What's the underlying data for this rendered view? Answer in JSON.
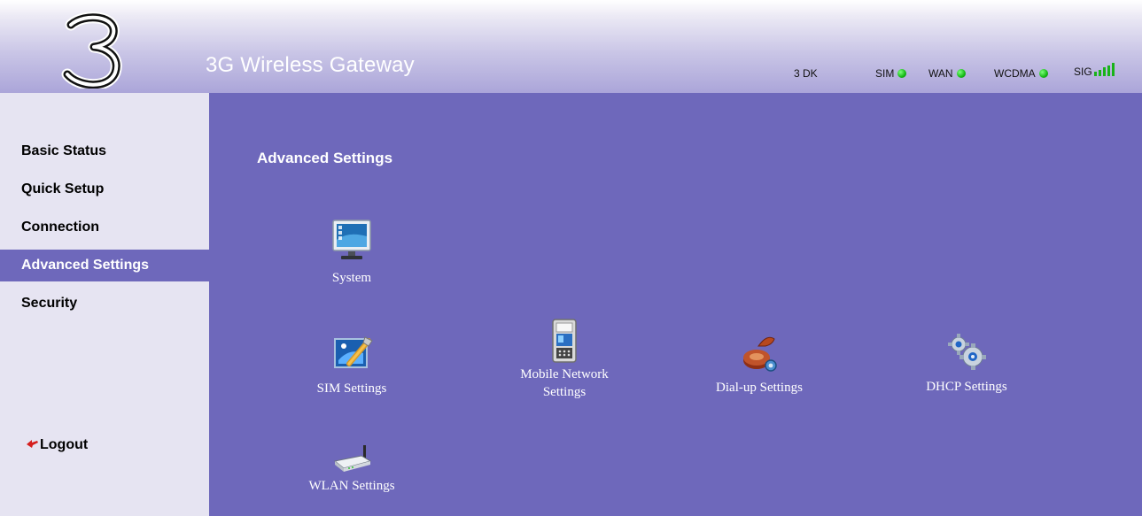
{
  "header": {
    "app_title": "3G Wireless Gateway",
    "logo_text": "3",
    "operator": "3 DK",
    "indicators": [
      {
        "label": "SIM",
        "state": "ok",
        "color": "#14b814"
      },
      {
        "label": "WAN",
        "state": "ok",
        "color": "#14b814"
      },
      {
        "label": "WCDMA",
        "state": "ok",
        "color": "#14b814"
      }
    ],
    "signal": {
      "label": "SIG",
      "bars": 5,
      "max_bars": 5,
      "color": "#19b319"
    }
  },
  "sidebar": {
    "items": [
      {
        "label": "Basic Status",
        "active": false
      },
      {
        "label": "Quick Setup",
        "active": false
      },
      {
        "label": "Connection",
        "active": false
      },
      {
        "label": "Advanced Settings",
        "active": true
      },
      {
        "label": "Security",
        "active": false
      }
    ],
    "logout_label": "Logout",
    "logout_icon": "red-arrow-icon"
  },
  "main": {
    "title": "Advanced Settings",
    "items": [
      {
        "label": "System",
        "icon": "monitor-icon"
      },
      {
        "label": "SIM Settings",
        "icon": "sim-tools-icon"
      },
      {
        "label": "Mobile Network Settings",
        "icon": "mobile-phone-icon"
      },
      {
        "label": "Dial-up Settings",
        "icon": "dialup-phone-icon"
      },
      {
        "label": "DHCP Settings",
        "icon": "gears-icon"
      },
      {
        "label": "WLAN Settings",
        "icon": "router-icon"
      }
    ]
  },
  "colors": {
    "accent": "#6e68bb",
    "sidebar_bg": "#e6e4f2",
    "header_bottom": "#aba5d9",
    "logout_arrow": "#d51e1e"
  }
}
